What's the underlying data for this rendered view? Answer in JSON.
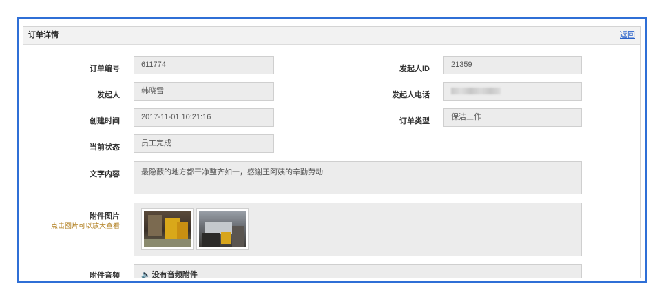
{
  "panel": {
    "title": "订单详情",
    "back_label": "返回"
  },
  "fields": {
    "order_no": {
      "label": "订单编号",
      "value": "611774"
    },
    "initiator_id": {
      "label": "发起人ID",
      "value": "21359"
    },
    "initiator": {
      "label": "发起人",
      "value": "韩晓雪"
    },
    "initiator_phone": {
      "label": "发起人电话",
      "value": ""
    },
    "created_time": {
      "label": "创建时间",
      "value": "2017-11-01 10:21:16"
    },
    "order_type": {
      "label": "订单类型",
      "value": "保洁工作"
    },
    "status": {
      "label": "当前状态",
      "value": "员工完成"
    },
    "text_content": {
      "label": "文字内容",
      "value": "最隐蔽的地方都干净整齐如一，感谢王阿姨的辛勤劳动"
    },
    "attachment_images": {
      "label": "附件图片",
      "hint": "点击图片可以放大查看"
    },
    "attachment_audio": {
      "label": "附件音频",
      "value": "没有音频附件"
    }
  },
  "colors": {
    "frame_border": "#2f6fd6",
    "link": "#2a62c9",
    "hint": "#b07d1c",
    "field_bg": "#ececec"
  },
  "icons": {
    "audio": "volume-icon"
  }
}
